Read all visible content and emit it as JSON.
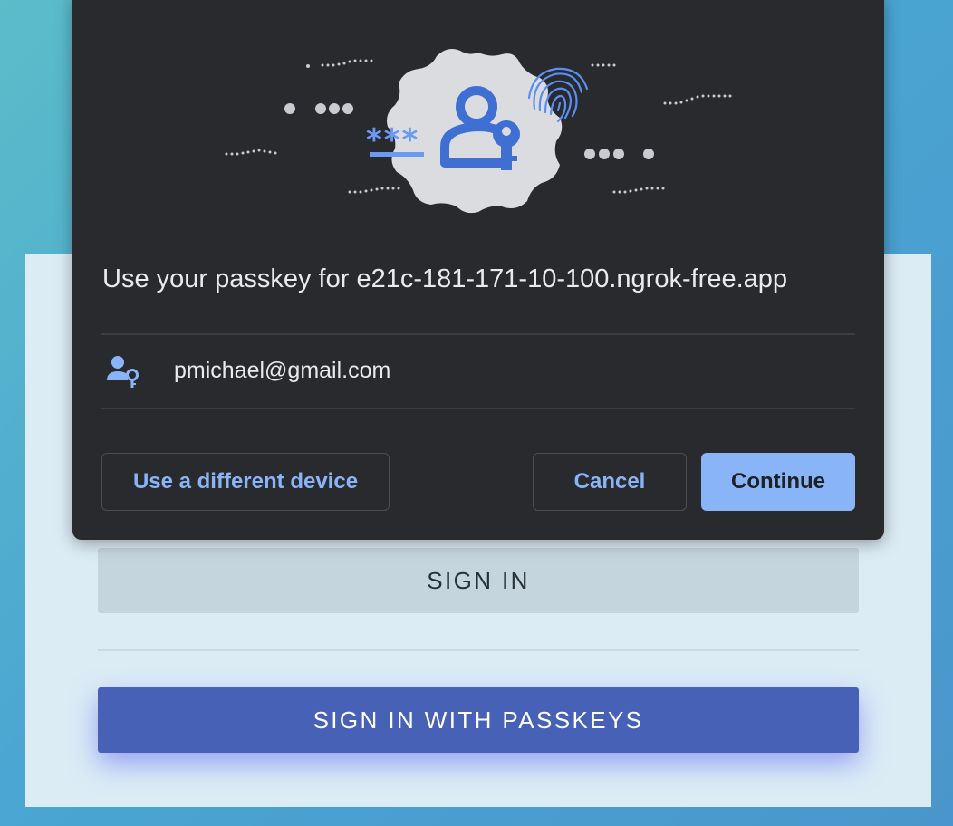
{
  "page": {
    "signin_label": "SIGN IN",
    "passkeys_label": "SIGN IN WITH PASSKEYS"
  },
  "dialog": {
    "title": "Use your passkey for e21c-181-171-10-100.ngrok-free.app",
    "account_icon": "person-key-icon",
    "account_email": "pmichael@gmail.com",
    "different_device_label": "Use a different device",
    "cancel_label": "Cancel",
    "continue_label": "Continue",
    "password_mask": "***"
  },
  "colors": {
    "dialog_bg": "#292a2d",
    "accent": "#8ab4f8",
    "illustration_blue": "#3f6fd3",
    "passkeys_button": "#4761b7",
    "signin_button": "#c5d5dd"
  }
}
